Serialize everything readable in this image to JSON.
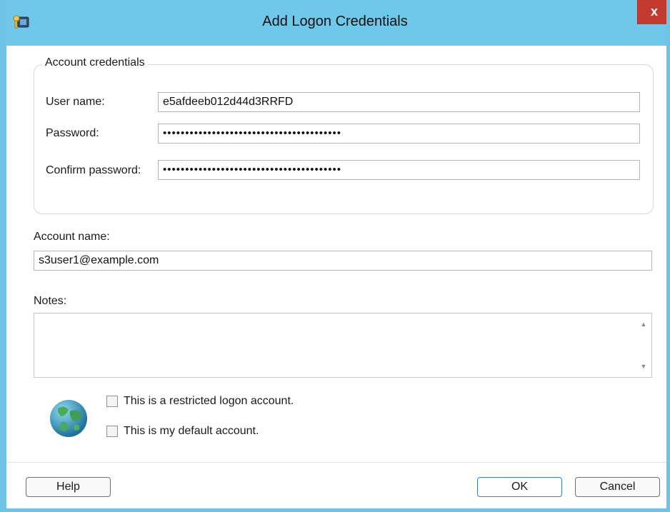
{
  "window": {
    "title": "Add Logon Credentials",
    "close_glyph": "x",
    "icon": "key-card-icon"
  },
  "account_credentials": {
    "legend": "Account credentials",
    "username_label": "User name:",
    "username_value": "e5afdeeb012d44d3RRFD",
    "password_label": "Password:",
    "password_value": "••••••••••••••••••••••••••••••••••••••••",
    "confirm_label": "Confirm password:",
    "confirm_value": "••••••••••••••••••••••••••••••••••••••••"
  },
  "account_name": {
    "label": "Account name:",
    "value": "s3user1@example.com"
  },
  "notes": {
    "label": "Notes:",
    "value": ""
  },
  "options": {
    "restricted_label": "This is a restricted logon account.",
    "restricted_checked": false,
    "default_label": "This is my default account.",
    "default_checked": false
  },
  "buttons": {
    "help": "Help",
    "ok": "OK",
    "cancel": "Cancel"
  },
  "colors": {
    "titlebar": "#6fc7ea",
    "close": "#c53a2f",
    "focus_border": "#3c7fb1"
  }
}
